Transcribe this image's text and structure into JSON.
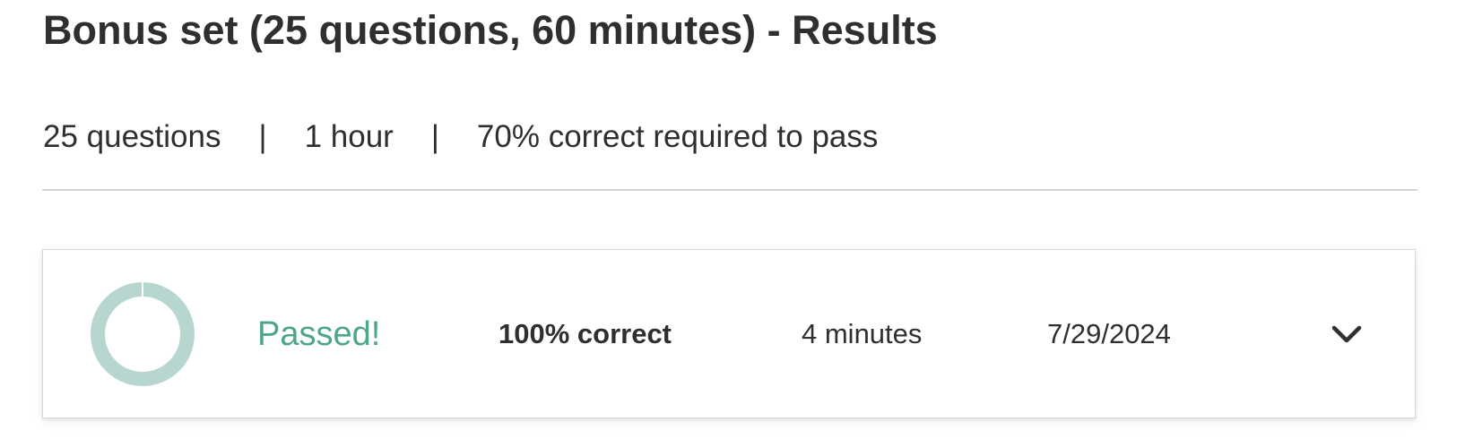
{
  "header": {
    "title": "Bonus set (25 questions, 60 minutes) - Results"
  },
  "meta": {
    "questions": "25 questions",
    "separator": "|",
    "duration": "1 hour",
    "pass_requirement": "70% correct required to pass"
  },
  "result": {
    "status": "Passed!",
    "score": "100% correct",
    "score_fraction": 1.0,
    "time_taken": "4 minutes",
    "date": "7/29/2024",
    "expand_icon": "chevron-down-icon"
  },
  "colors": {
    "pass_text": "#4fa58a",
    "donut_ring": "#b8d6d0",
    "text": "#2d2f31",
    "divider": "#d1d7dc"
  }
}
